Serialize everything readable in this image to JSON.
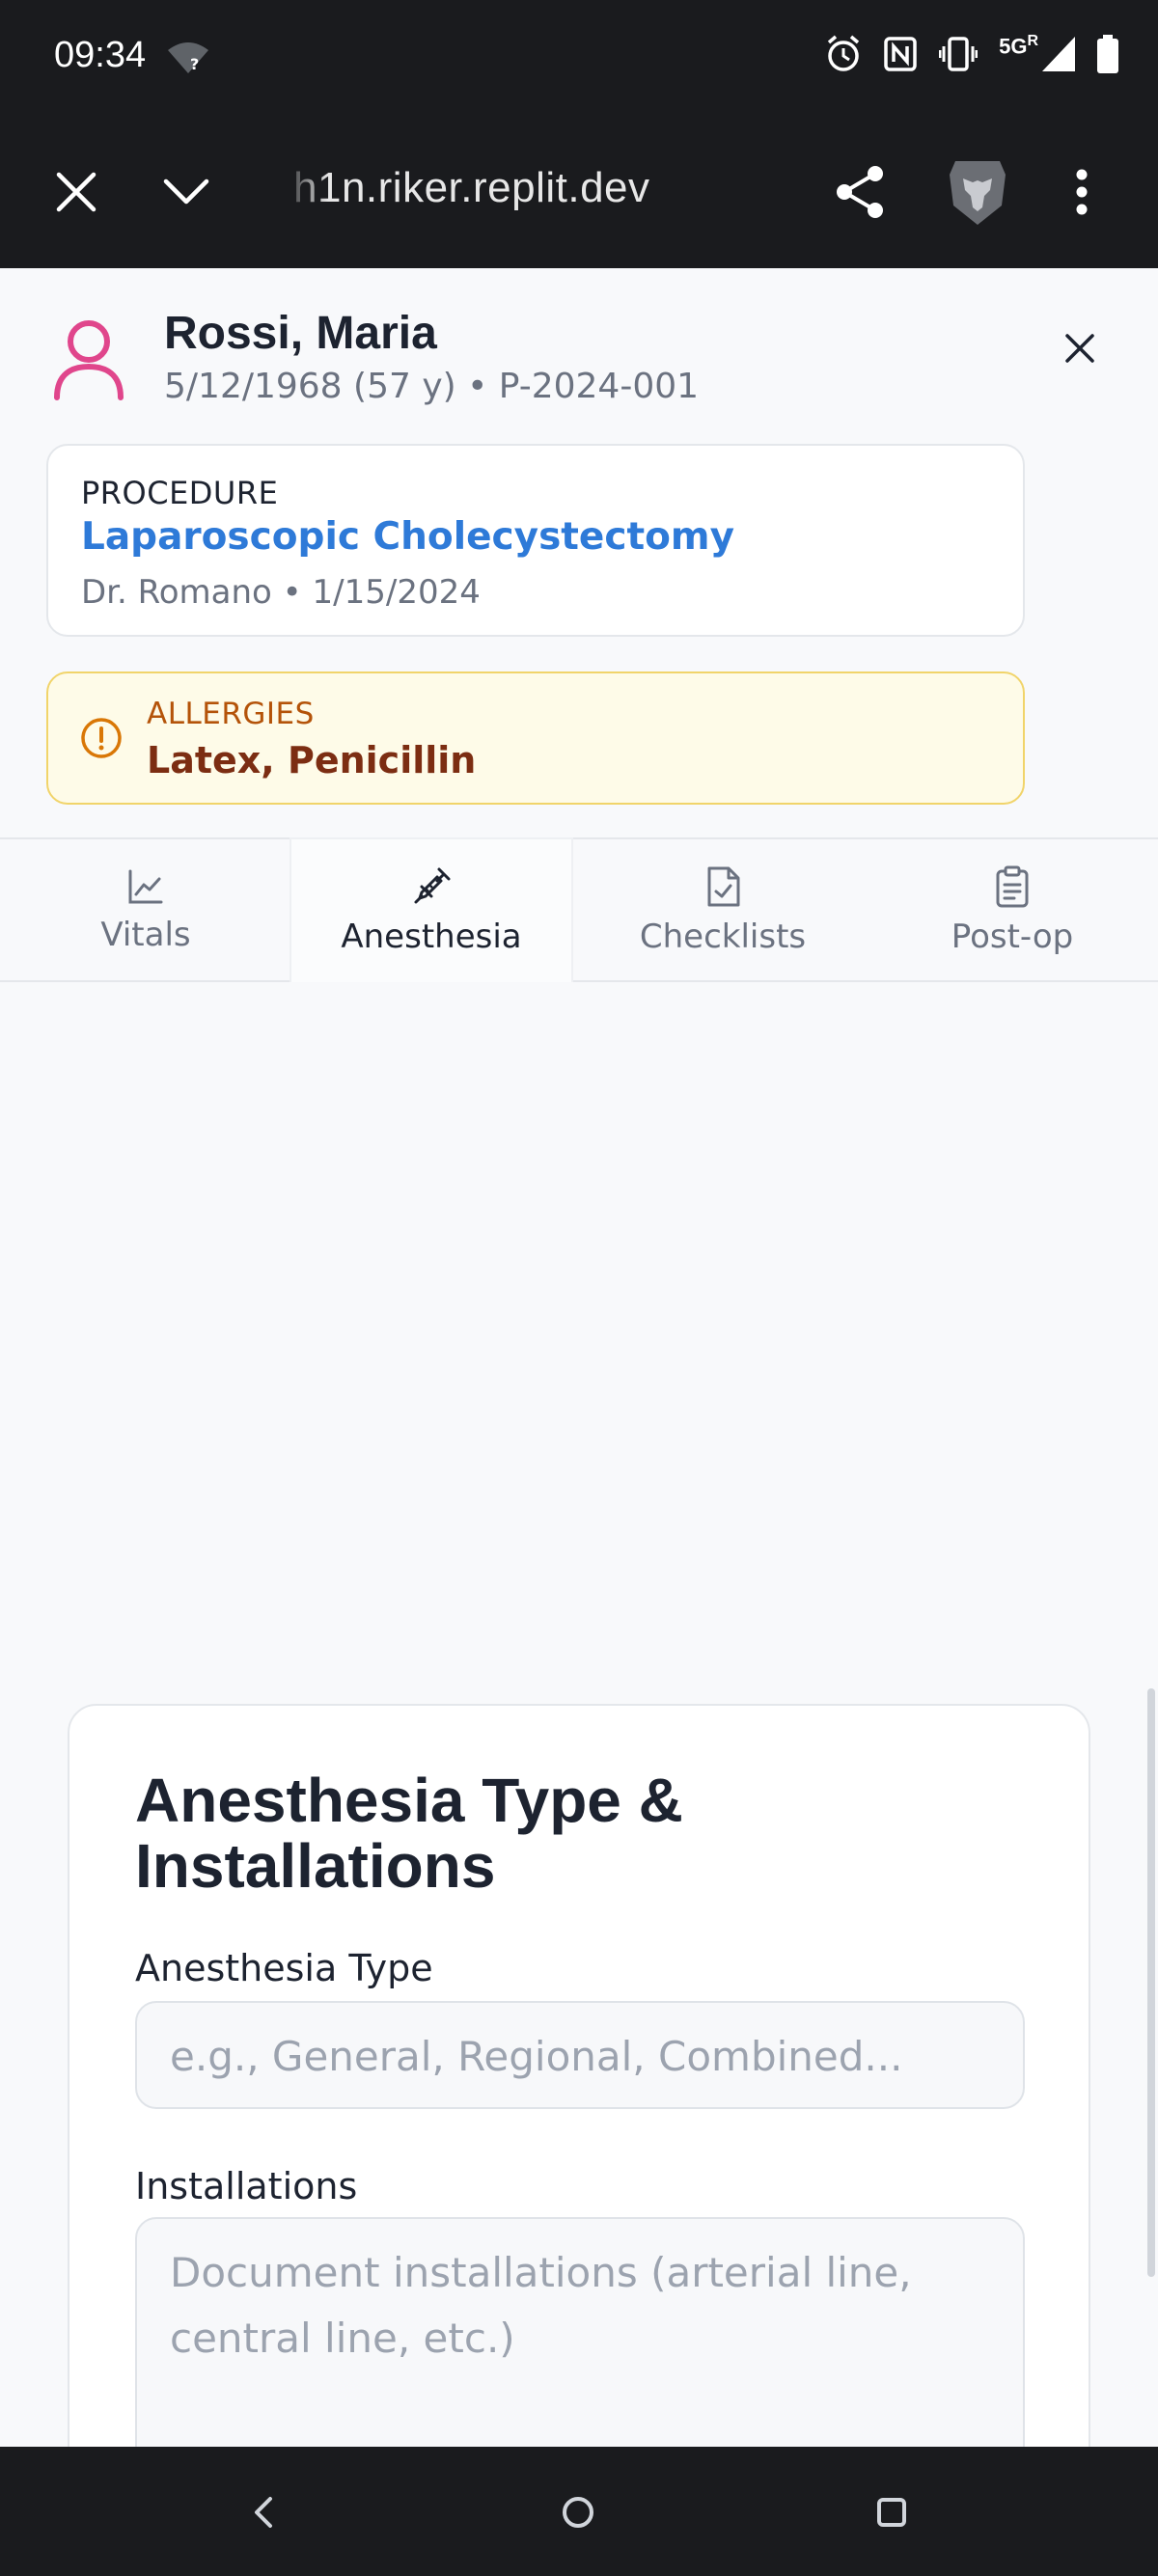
{
  "status_bar": {
    "time": "09:34",
    "network": "5G",
    "network_sup": "R",
    "icons": [
      "wifi-unknown-icon",
      "alarm-icon",
      "nfc-icon",
      "vibrate-icon",
      "signal-icon",
      "battery-icon"
    ]
  },
  "browser": {
    "url": "h1n.riker.replit.dev",
    "icons": [
      "close-icon",
      "chevron-down-icon",
      "share-icon",
      "brave-lion-icon",
      "more-vert-icon"
    ]
  },
  "patient": {
    "name": "Rossi, Maria",
    "meta": "5/12/1968 (57 y) • P-2024-001",
    "avatar_color": "#e0468c"
  },
  "procedure": {
    "label": "PROCEDURE",
    "name": "Laparoscopic Cholecystectomy",
    "meta": "Dr. Romano • 1/15/2024"
  },
  "allergies": {
    "label": "ALLERGIES",
    "value": "Latex, Penicillin"
  },
  "tabs": [
    {
      "label": "Vitals",
      "icon": "chart-line-icon",
      "active": false
    },
    {
      "label": "Anesthesia",
      "icon": "syringe-icon",
      "active": true
    },
    {
      "label": "Checklists",
      "icon": "file-check-icon",
      "active": false
    },
    {
      "label": "Post-op",
      "icon": "clipboard-icon",
      "active": false
    }
  ],
  "section": {
    "title": "Anesthesia Type & Installations",
    "type_label": "Anesthesia Type",
    "type_placeholder": "e.g., General, Regional, Combined...",
    "installations_label": "Installations",
    "installations_placeholder": "Document installations (arterial line, central line, etc.)"
  },
  "colors": {
    "accent_blue": "#2e7ad8",
    "allergy_bg": "#fefbe8",
    "allergy_border": "#f1d46a",
    "allergy_text": "#7c2d12"
  }
}
